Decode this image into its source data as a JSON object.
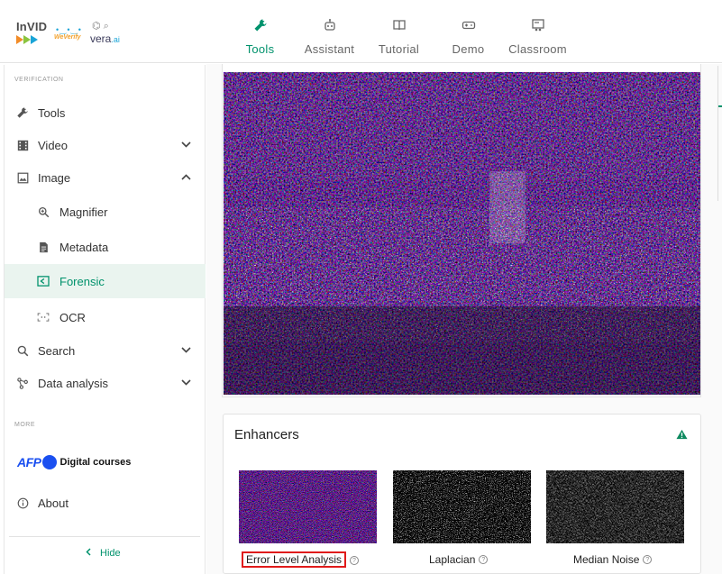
{
  "brand": {
    "invid": "InVID",
    "weverify": "WeVerify",
    "vera": "vera",
    "vera_suffix": ".ai"
  },
  "nav": {
    "tabs": [
      {
        "label": "Tools",
        "icon": "wrench-icon",
        "active": true
      },
      {
        "label": "Assistant",
        "icon": "robot-icon",
        "active": false
      },
      {
        "label": "Tutorial",
        "icon": "book-icon",
        "active": false
      },
      {
        "label": "Demo",
        "icon": "gamepad-icon",
        "active": false
      },
      {
        "label": "Classroom",
        "icon": "classroom-icon",
        "active": false
      }
    ]
  },
  "sidebar": {
    "section_verification": "VERIFICATION",
    "section_more": "MORE",
    "items": [
      {
        "label": "Tools",
        "icon": "wrench-icon"
      },
      {
        "label": "Video",
        "icon": "film-icon",
        "chevron": "down"
      },
      {
        "label": "Image",
        "icon": "image-icon",
        "chevron": "up"
      },
      {
        "label": "Magnifier",
        "icon": "magnifier-icon"
      },
      {
        "label": "Metadata",
        "icon": "document-icon"
      },
      {
        "label": "Forensic",
        "icon": "forensic-icon",
        "active": true
      },
      {
        "label": "OCR",
        "icon": "ocr-icon"
      },
      {
        "label": "Search",
        "icon": "search-icon",
        "chevron": "down"
      },
      {
        "label": "Data analysis",
        "icon": "network-icon",
        "chevron": "down"
      }
    ],
    "afp_logo": "AFP",
    "afp_label": "Digital courses",
    "about_label": "About",
    "hide_label": "Hide"
  },
  "enhancers": {
    "title": "Enhancers",
    "filters": [
      {
        "label": "Error Level Analysis",
        "selected": true
      },
      {
        "label": "Laplacian",
        "selected": false
      },
      {
        "label": "Median Noise",
        "selected": false
      }
    ]
  },
  "colors": {
    "accent": "#00926c",
    "active_bg": "#eaf4ef",
    "highlight_border": "#e01b1b"
  }
}
